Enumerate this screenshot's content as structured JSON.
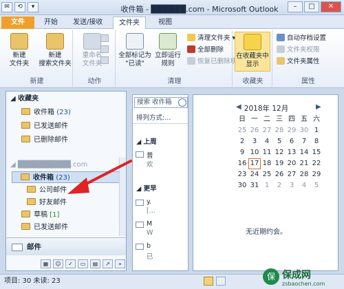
{
  "window": {
    "title": "收件箱 - ██████.com - Microsoft Outlook",
    "controls": [
      "–",
      "□",
      "✕"
    ]
  },
  "qat": [
    "✉",
    "⟲",
    "▾"
  ],
  "tabs": [
    {
      "label": "文件",
      "type": "file"
    },
    {
      "label": "开始"
    },
    {
      "label": "发送/接收"
    },
    {
      "label": "文件夹",
      "active": true
    },
    {
      "label": "视图"
    }
  ],
  "ribbon": {
    "groups": [
      {
        "label": "新建",
        "buttons": [
          "新建\n文件夹",
          "新建\n搜索文件夹"
        ]
      },
      {
        "label": "动作",
        "buttons": [
          "重命名\n文件夹"
        ],
        "small": []
      },
      {
        "label": "清理",
        "buttons": [
          "全部标记为\n\"已读\"",
          "立即运行\n规则"
        ],
        "small": [
          "清理文件夹 ▾",
          "全部删除",
          "恢复已删除项"
        ]
      },
      {
        "label": "收藏夹",
        "buttons": [
          "在收藏夹中\n显示"
        ]
      },
      {
        "label": "属性",
        "small": [
          "自动存档设置",
          "文件夹权限",
          "文件夹属性"
        ]
      }
    ]
  },
  "nav": {
    "favorites_header": "收藏夹",
    "favorites": [
      {
        "label": "收件箱",
        "count": "(23)"
      },
      {
        "label": "已发送邮件"
      },
      {
        "label": "已删除邮件"
      }
    ],
    "account": "██████████.com",
    "account_folders": [
      {
        "label": "收件箱",
        "count": "(23)",
        "selected": true
      },
      {
        "label": "公司邮件"
      },
      {
        "label": "好友邮件"
      },
      {
        "label": "草稿",
        "count": "[1]"
      },
      {
        "label": "已发送邮件"
      }
    ],
    "mail_button": "邮件"
  },
  "list": {
    "search_placeholder": "搜索 收件箱",
    "sort": "排列方式:...",
    "groups": [
      {
        "label": "上周",
        "items": [
          {
            "sender": "普",
            "preview": "欢"
          }
        ]
      },
      {
        "label": "更早",
        "items": [
          {
            "sender": "y.",
            "preview": "[..."
          },
          {
            "sender": "M",
            "preview": "W"
          },
          {
            "sender": "b",
            "preview": "已"
          }
        ]
      }
    ]
  },
  "calendar": {
    "title": "2018年 12月",
    "weekdays": [
      "日",
      "一",
      "二",
      "三",
      "四",
      "五",
      "六"
    ],
    "weeks": [
      [
        "25",
        "26",
        "27",
        "28",
        "29",
        "30",
        "1"
      ],
      [
        "2",
        "3",
        "4",
        "5",
        "6",
        "7",
        "8"
      ],
      [
        "9",
        "10",
        "11",
        "12",
        "13",
        "14",
        "15"
      ],
      [
        "16",
        "17",
        "18",
        "19",
        "20",
        "21",
        "22"
      ],
      [
        "23",
        "24",
        "25",
        "26",
        "27",
        "28",
        "29"
      ],
      [
        "30",
        "31",
        "1",
        "2",
        "3",
        "4",
        "5"
      ]
    ],
    "today": "17",
    "no_appointments": "无近期约会。"
  },
  "status": {
    "text": "项目: 30    未读: 23"
  },
  "watermark": {
    "title": "保成网",
    "url": "zsbaochen.com"
  },
  "colors": {
    "file_tab": "#f0a02a",
    "selected": "#cfe0f5",
    "arrow": "#e02323"
  }
}
